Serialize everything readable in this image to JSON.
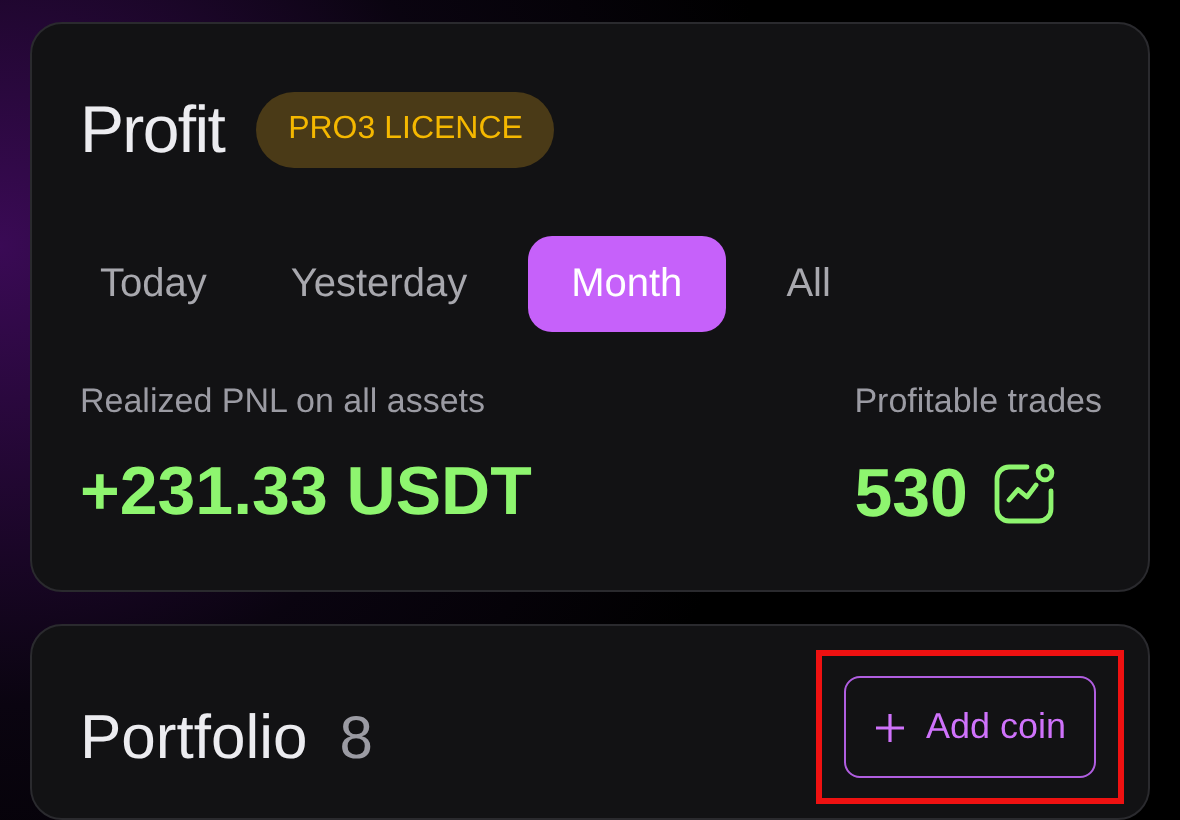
{
  "profit": {
    "title": "Profit",
    "badge": "PRO3 LICENCE",
    "tabs": [
      {
        "label": "Today",
        "selected": false
      },
      {
        "label": "Yesterday",
        "selected": false
      },
      {
        "label": "Month",
        "selected": true
      },
      {
        "label": "All",
        "selected": false
      }
    ],
    "realized_pnl": {
      "label": "Realized PNL on all assets",
      "value": "+231.33 USDT"
    },
    "profitable_trades": {
      "label": "Profitable trades",
      "value": "530"
    }
  },
  "portfolio": {
    "title": "Portfolio",
    "count": "8",
    "add_button": {
      "label": "Add coin",
      "highlighted": true
    }
  }
}
